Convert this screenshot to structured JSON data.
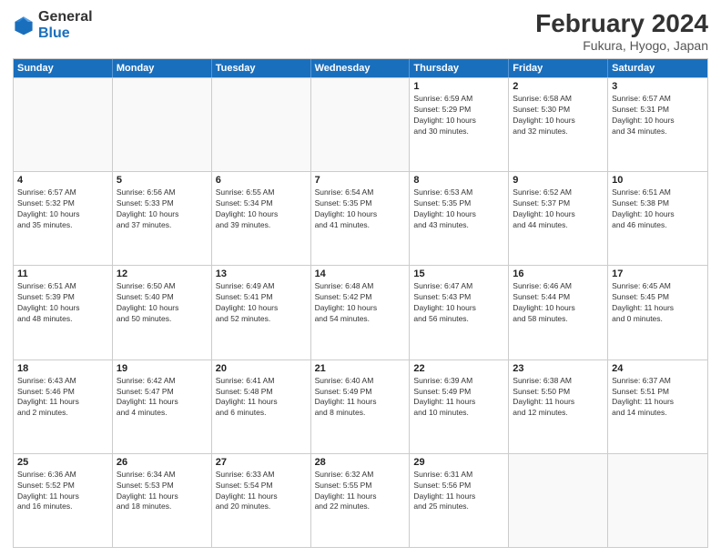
{
  "logo": {
    "line1": "General",
    "line2": "Blue"
  },
  "title": "February 2024",
  "subtitle": "Fukura, Hyogo, Japan",
  "header_days": [
    "Sunday",
    "Monday",
    "Tuesday",
    "Wednesday",
    "Thursday",
    "Friday",
    "Saturday"
  ],
  "rows": [
    [
      {
        "day": "",
        "info": ""
      },
      {
        "day": "",
        "info": ""
      },
      {
        "day": "",
        "info": ""
      },
      {
        "day": "",
        "info": ""
      },
      {
        "day": "1",
        "info": "Sunrise: 6:59 AM\nSunset: 5:29 PM\nDaylight: 10 hours\nand 30 minutes."
      },
      {
        "day": "2",
        "info": "Sunrise: 6:58 AM\nSunset: 5:30 PM\nDaylight: 10 hours\nand 32 minutes."
      },
      {
        "day": "3",
        "info": "Sunrise: 6:57 AM\nSunset: 5:31 PM\nDaylight: 10 hours\nand 34 minutes."
      }
    ],
    [
      {
        "day": "4",
        "info": "Sunrise: 6:57 AM\nSunset: 5:32 PM\nDaylight: 10 hours\nand 35 minutes."
      },
      {
        "day": "5",
        "info": "Sunrise: 6:56 AM\nSunset: 5:33 PM\nDaylight: 10 hours\nand 37 minutes."
      },
      {
        "day": "6",
        "info": "Sunrise: 6:55 AM\nSunset: 5:34 PM\nDaylight: 10 hours\nand 39 minutes."
      },
      {
        "day": "7",
        "info": "Sunrise: 6:54 AM\nSunset: 5:35 PM\nDaylight: 10 hours\nand 41 minutes."
      },
      {
        "day": "8",
        "info": "Sunrise: 6:53 AM\nSunset: 5:35 PM\nDaylight: 10 hours\nand 43 minutes."
      },
      {
        "day": "9",
        "info": "Sunrise: 6:52 AM\nSunset: 5:37 PM\nDaylight: 10 hours\nand 44 minutes."
      },
      {
        "day": "10",
        "info": "Sunrise: 6:51 AM\nSunset: 5:38 PM\nDaylight: 10 hours\nand 46 minutes."
      }
    ],
    [
      {
        "day": "11",
        "info": "Sunrise: 6:51 AM\nSunset: 5:39 PM\nDaylight: 10 hours\nand 48 minutes."
      },
      {
        "day": "12",
        "info": "Sunrise: 6:50 AM\nSunset: 5:40 PM\nDaylight: 10 hours\nand 50 minutes."
      },
      {
        "day": "13",
        "info": "Sunrise: 6:49 AM\nSunset: 5:41 PM\nDaylight: 10 hours\nand 52 minutes."
      },
      {
        "day": "14",
        "info": "Sunrise: 6:48 AM\nSunset: 5:42 PM\nDaylight: 10 hours\nand 54 minutes."
      },
      {
        "day": "15",
        "info": "Sunrise: 6:47 AM\nSunset: 5:43 PM\nDaylight: 10 hours\nand 56 minutes."
      },
      {
        "day": "16",
        "info": "Sunrise: 6:46 AM\nSunset: 5:44 PM\nDaylight: 10 hours\nand 58 minutes."
      },
      {
        "day": "17",
        "info": "Sunrise: 6:45 AM\nSunset: 5:45 PM\nDaylight: 11 hours\nand 0 minutes."
      }
    ],
    [
      {
        "day": "18",
        "info": "Sunrise: 6:43 AM\nSunset: 5:46 PM\nDaylight: 11 hours\nand 2 minutes."
      },
      {
        "day": "19",
        "info": "Sunrise: 6:42 AM\nSunset: 5:47 PM\nDaylight: 11 hours\nand 4 minutes."
      },
      {
        "day": "20",
        "info": "Sunrise: 6:41 AM\nSunset: 5:48 PM\nDaylight: 11 hours\nand 6 minutes."
      },
      {
        "day": "21",
        "info": "Sunrise: 6:40 AM\nSunset: 5:49 PM\nDaylight: 11 hours\nand 8 minutes."
      },
      {
        "day": "22",
        "info": "Sunrise: 6:39 AM\nSunset: 5:49 PM\nDaylight: 11 hours\nand 10 minutes."
      },
      {
        "day": "23",
        "info": "Sunrise: 6:38 AM\nSunset: 5:50 PM\nDaylight: 11 hours\nand 12 minutes."
      },
      {
        "day": "24",
        "info": "Sunrise: 6:37 AM\nSunset: 5:51 PM\nDaylight: 11 hours\nand 14 minutes."
      }
    ],
    [
      {
        "day": "25",
        "info": "Sunrise: 6:36 AM\nSunset: 5:52 PM\nDaylight: 11 hours\nand 16 minutes."
      },
      {
        "day": "26",
        "info": "Sunrise: 6:34 AM\nSunset: 5:53 PM\nDaylight: 11 hours\nand 18 minutes."
      },
      {
        "day": "27",
        "info": "Sunrise: 6:33 AM\nSunset: 5:54 PM\nDaylight: 11 hours\nand 20 minutes."
      },
      {
        "day": "28",
        "info": "Sunrise: 6:32 AM\nSunset: 5:55 PM\nDaylight: 11 hours\nand 22 minutes."
      },
      {
        "day": "29",
        "info": "Sunrise: 6:31 AM\nSunset: 5:56 PM\nDaylight: 11 hours\nand 25 minutes."
      },
      {
        "day": "",
        "info": ""
      },
      {
        "day": "",
        "info": ""
      }
    ]
  ]
}
